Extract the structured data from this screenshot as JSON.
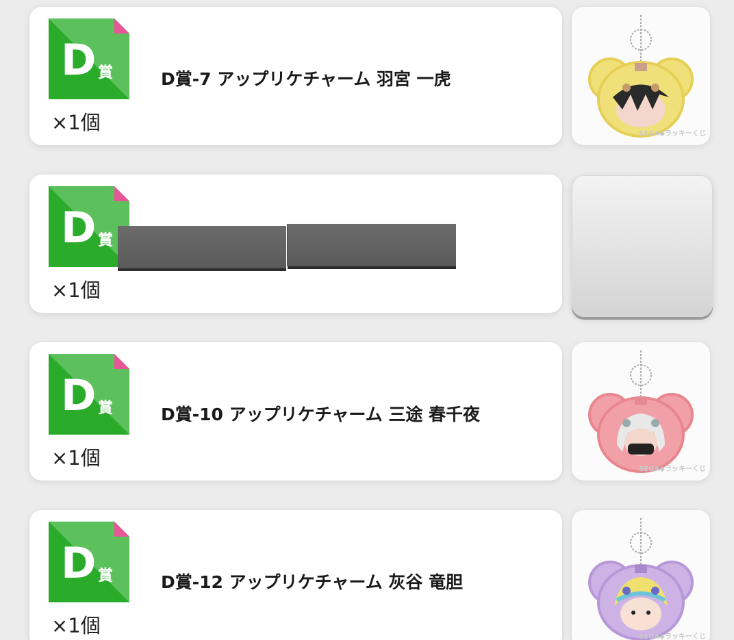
{
  "badge": {
    "letter": "D",
    "kanji": "賞",
    "green": "#2aab2a",
    "light_green": "#5cc05c",
    "corner": "#e8569a"
  },
  "watermark": "SEGA◆ラッキーくじ",
  "items": [
    {
      "name": "D賞-7 アップリケチャーム 羽宮 一虎",
      "qty": "×1個",
      "charm_color": "#f0e07a",
      "charm_edge": "#e6cf55",
      "hair": "#2a2a2a",
      "state": "shown"
    },
    {
      "name": "",
      "qty": "×1個",
      "state": "hidden"
    },
    {
      "name": "D賞-10 アップリケチャーム 三途 春千夜",
      "qty": "×1個",
      "charm_color": "#f2a0a8",
      "charm_edge": "#e8868f",
      "hair": "#e8e8e8",
      "state": "shown"
    },
    {
      "name": "D賞-12 アップリケチャーム 灰谷 竜胆",
      "qty": "×1個",
      "charm_color": "#cdb2e6",
      "charm_edge": "#b797d8",
      "hair": "#f0e070",
      "state": "shown"
    }
  ]
}
